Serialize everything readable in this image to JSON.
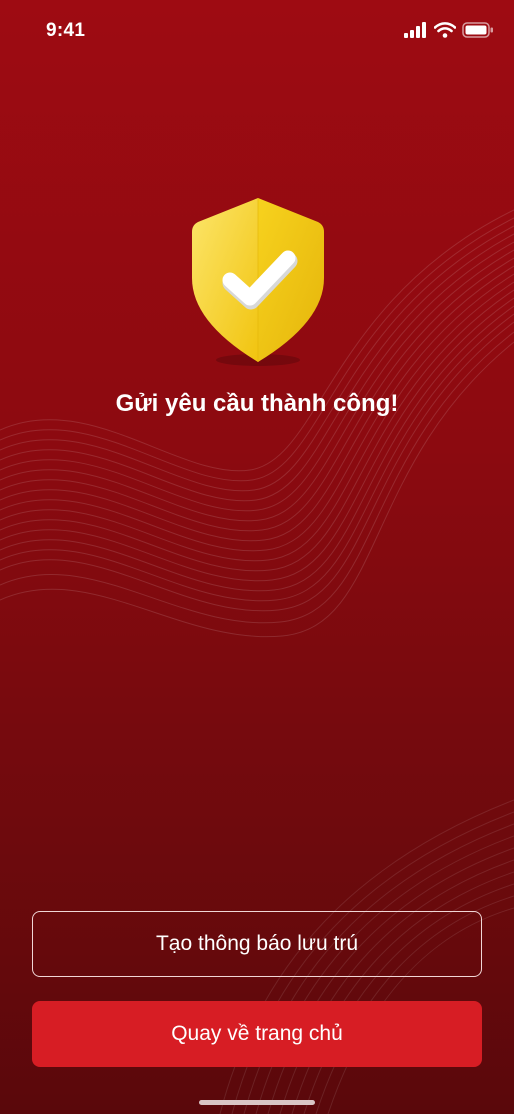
{
  "status_bar": {
    "time": "9:41"
  },
  "main": {
    "title": "Gửi yêu cầu thành công!"
  },
  "actions": {
    "create_notice_label": "Tạo thông báo lưu trú",
    "back_home_label": "Quay về trang chủ"
  },
  "colors": {
    "background_top": "#9e0b12",
    "background_bottom": "#5a080b",
    "primary_button": "#d71d24",
    "shield_yellow": "#f7d21e"
  },
  "icons": {
    "signal": "cellular-signal-icon",
    "wifi": "wifi-icon",
    "battery": "battery-icon",
    "success": "shield-check-icon"
  }
}
